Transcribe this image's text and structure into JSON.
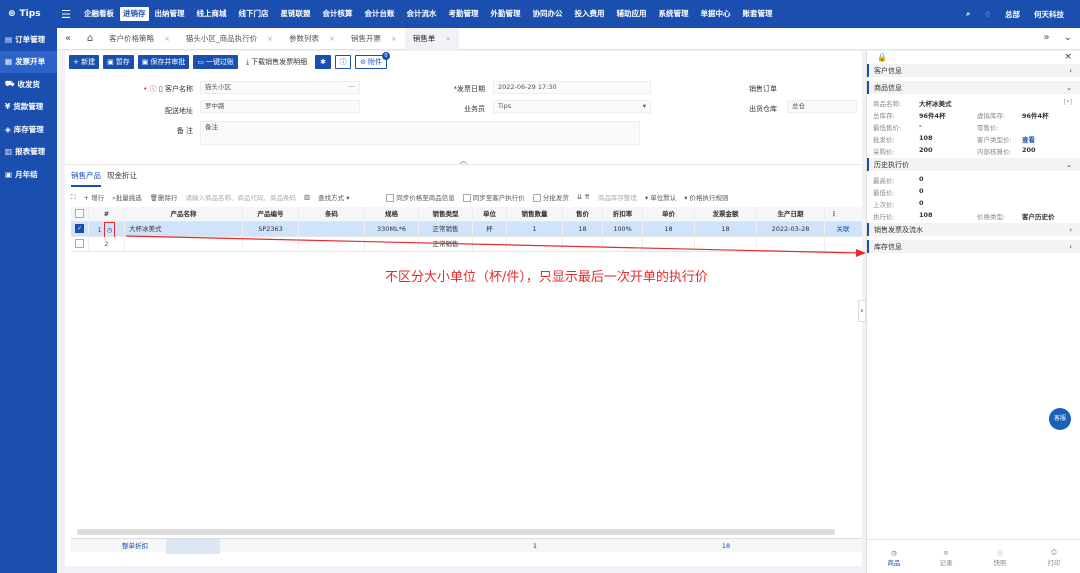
{
  "topbar": {
    "logo": "Tips",
    "nav": [
      "企融看板",
      "进销存",
      "出纳管理",
      "线上商城",
      "线下门店",
      "星链联盟",
      "会计核算",
      "会计台账",
      "会计流水",
      "考勤管理",
      "外勤管理",
      "协同办公",
      "投入费用",
      "辅助应用",
      "系统管理",
      "单据中心",
      "账套管理"
    ],
    "active": "进销存",
    "right": [
      "总部",
      "何天科技"
    ]
  },
  "sidebar": [
    "订单管理",
    "发票开单",
    "收发货",
    "货款管理",
    "库存管理",
    "报表管理",
    "月年结"
  ],
  "tabs": [
    "客户价格策略",
    "猫头小区_商品执行价",
    "参数列表",
    "销售开票",
    "销售单"
  ],
  "toolbar": {
    "new": "+ 新建",
    "draft": "暂存",
    "save_submit": "保存并审批",
    "one_click": "一键过账",
    "download": "下载销售发票明细",
    "attach": "附件",
    "attach_count": "0"
  },
  "form": {
    "customer_label": "客户名称",
    "customer_value": "猫头小区",
    "address_label": "配送地址",
    "address_value": "罗中路",
    "note_label": "备   注",
    "note_value": "备注",
    "date_label": "*发票日期",
    "date_value": "2022-06-29 17:30",
    "salesman_label": "业务员",
    "salesman_value": "Tips",
    "order_label": "销售订单",
    "warehouse_label": "出货仓库",
    "warehouse_value": "总仓"
  },
  "subtabs": [
    "销售产品",
    "现金折让"
  ],
  "gridtool": {
    "add_row": "+ 增行",
    "batch_select": "批量挑选",
    "delete_row": "删除行",
    "search_placeholder": "请输入商品名称、商品代码、商品条码",
    "search_mode": "查找方式",
    "cb1": "同步价格至商品信息",
    "cb2": "同步至客户执行价",
    "cb3": "分批发货",
    "sort": "商品库存整理",
    "unit": "单位默认",
    "price_rule": "价格执行规则"
  },
  "grid": {
    "headers": [
      "#",
      "产品名称",
      "产品编号",
      "条码",
      "规格",
      "销售类型",
      "单位",
      "销售数量",
      "售价",
      "折扣率",
      "单价",
      "发票金额",
      "生产日期"
    ],
    "rows": [
      {
        "no": "1",
        "name": "大杯冰美式",
        "code": "SP2363",
        "barcode": "",
        "spec": "330ML*6",
        "type": "正常销售",
        "unit": "杯",
        "qty": "1",
        "price": "18",
        "discount": "100%",
        "unit_price": "18",
        "amount": "18",
        "date": "2022-03-28",
        "link": "关联"
      },
      {
        "no": "2",
        "name": "",
        "code": "",
        "barcode": "",
        "spec": "",
        "type": "正常销售",
        "unit": "",
        "qty": "",
        "price": "",
        "discount": "",
        "unit_price": "",
        "amount": "",
        "date": ""
      }
    ],
    "footer_label": "整单折扣",
    "footer_qty": "1",
    "footer_amount": "18"
  },
  "annotation": "不区分大小单位（杯/件），只显示最后一次开单的执行价",
  "panel": {
    "sec_customer": "客户信息",
    "sec_goods": "商品信息",
    "goods": {
      "name_k": "商品名称:",
      "name_v": "大杯冰美式",
      "stock_k": "总库存:",
      "stock_v": "96件4杯",
      "vstock_k": "虚拟库存:",
      "vstock_v": "96件4杯",
      "min_k": "最低售价:",
      "min_v": "-",
      "retail_k": "零售价:",
      "wholesale_k": "批发价:",
      "wholesale_v": "108",
      "ctype_k": "客户类型价:",
      "ctype_v": "查看",
      "purchase_k": "采购价:",
      "purchase_v": "200",
      "internal_k": "内部核算价:",
      "internal_v": "200"
    },
    "sec_history": "历史执行价",
    "history": {
      "max_k": "最高价:",
      "max_v": "0",
      "min_k": "最低价:",
      "min_v": "0",
      "last_k": "上次价:",
      "last_v": "0",
      "exec_k": "执行价:",
      "exec_v": "108",
      "ptype_k": "价格类型:",
      "ptype_v": "客户历史价"
    },
    "sec_invoice": "销售发票及流水",
    "sec_stock": "库存信息",
    "bottom_tabs": [
      "商品",
      "记录",
      "快照",
      "打印"
    ],
    "kefu": "客服"
  }
}
